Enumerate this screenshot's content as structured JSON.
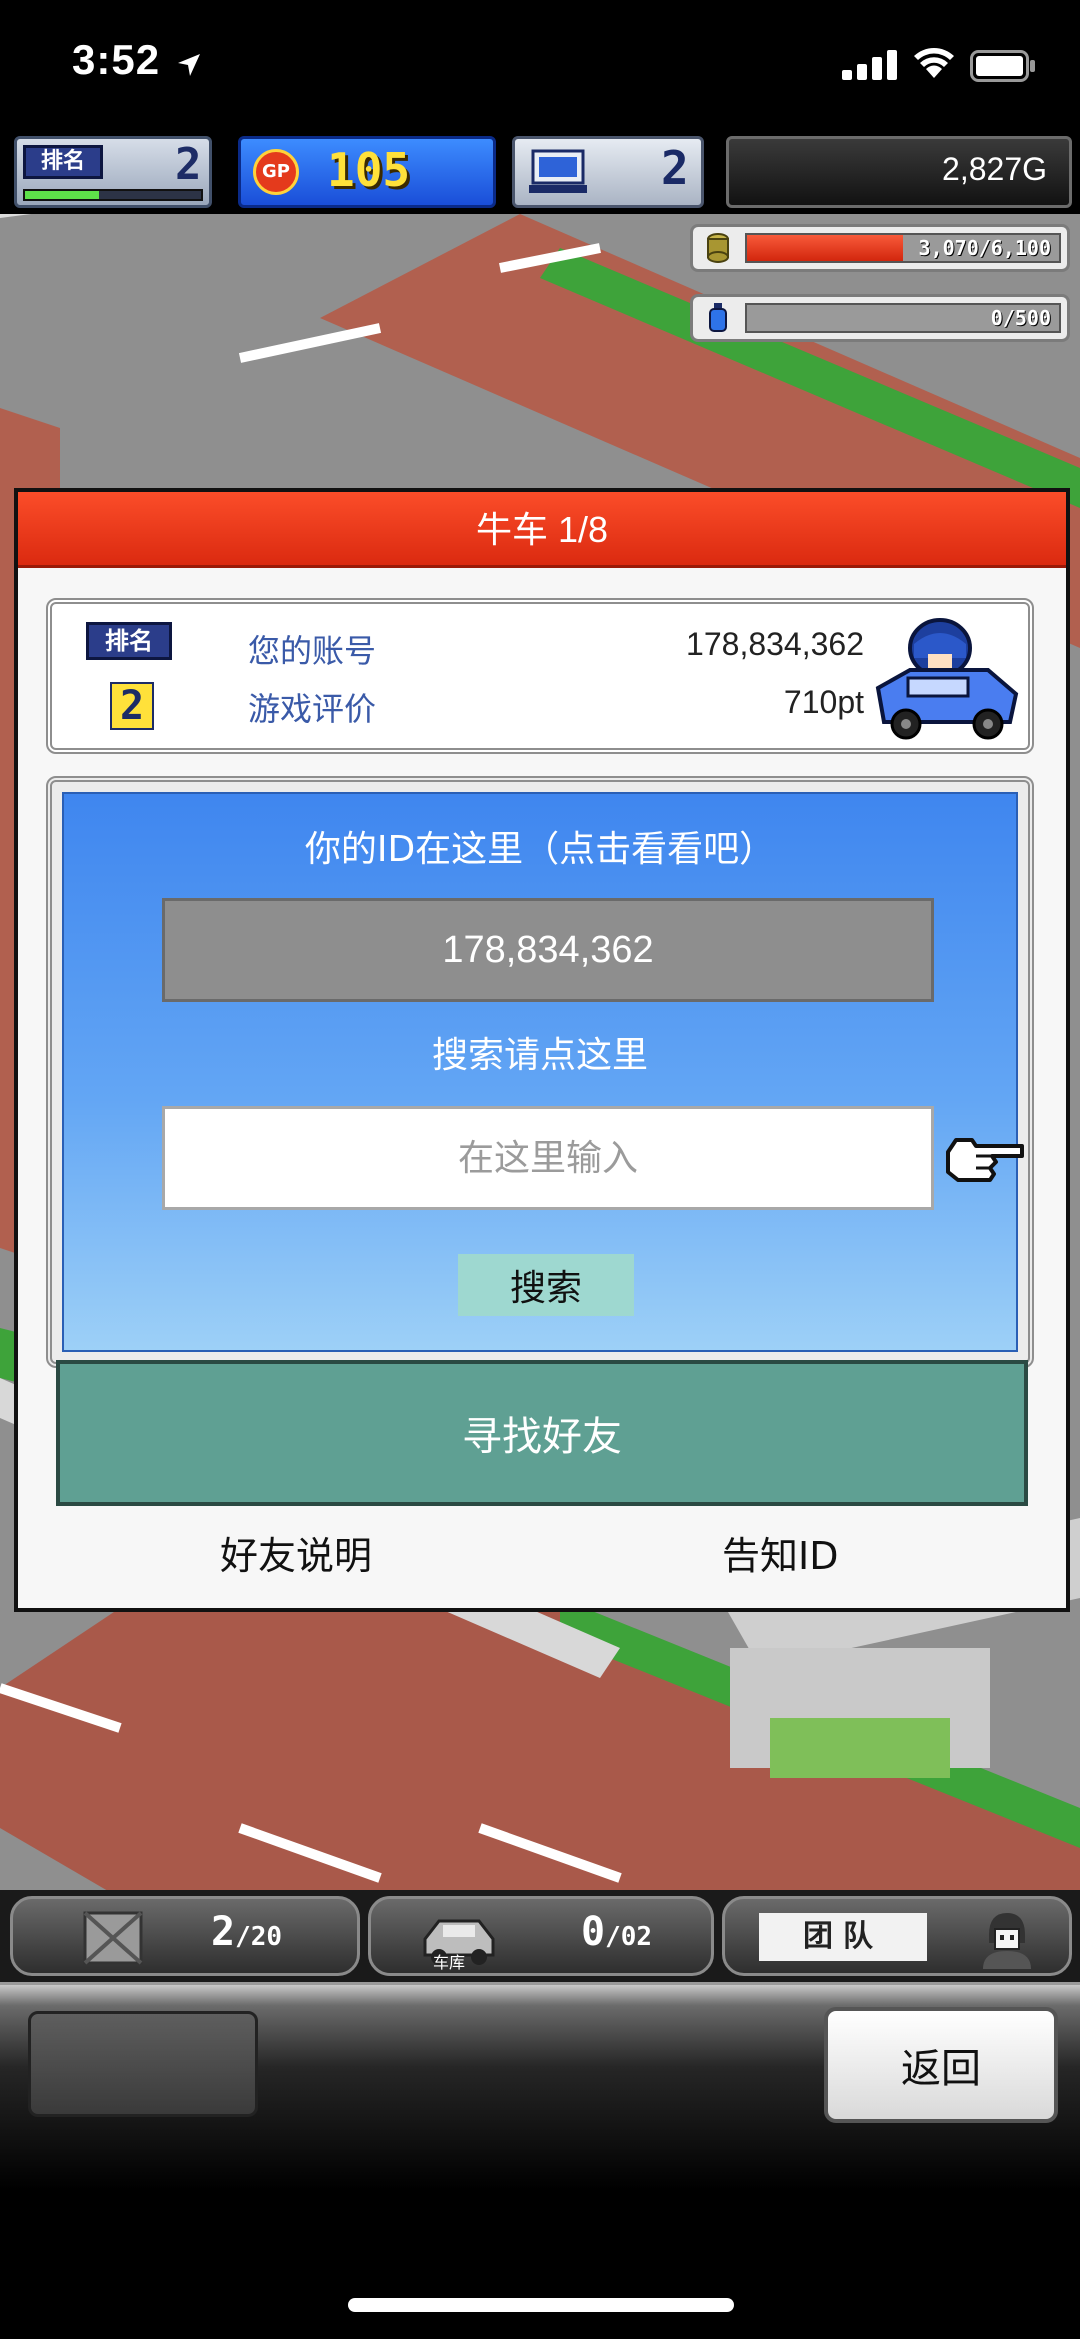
{
  "status_bar": {
    "time": "3:52"
  },
  "hud": {
    "rank_badge": "排名",
    "rank_value": "2",
    "rank_progress": 0.42,
    "gp_badge": "GP",
    "gp_value": "105",
    "pc_value": "2",
    "money": "2,827G",
    "resource1_text": "3,070/6,100",
    "resource1_fraction": 0.5,
    "resource2_text": "0/500",
    "resource2_fraction": 0.0
  },
  "dialog": {
    "title": "牛车 1/8",
    "rank_badge": "排名",
    "rank_value": "2",
    "account_label": "您的账号",
    "account_value": "178,834,362",
    "rating_label": "游戏评价",
    "rating_value": "710pt",
    "id_caption": "你的ID在这里（点击看看吧）",
    "id_value": "178,834,362",
    "search_caption": "搜索请点这里",
    "search_placeholder": "在这里输入",
    "search_button": "搜索",
    "find_friend_button": "寻找好友",
    "friend_help_link": "好友说明",
    "notify_id_link": "告知ID"
  },
  "bottom_status": {
    "crate_count": "2",
    "crate_max": "/20",
    "garage_count": "0",
    "garage_max": "/02",
    "garage_label": "车库",
    "team_label": "团队"
  },
  "command_bar": {
    "back_button": "返回"
  },
  "icons": {
    "location": "location-arrow-icon",
    "signal": "cellular-signal-icon",
    "wifi": "wifi-icon",
    "battery": "battery-icon",
    "gp": "gp-coin-icon",
    "computer": "computer-icon",
    "coins": "coin-stack-icon",
    "bottle": "blue-bottle-icon",
    "car": "car-driver-icon",
    "hand": "pointing-hand-icon",
    "crate": "crate-icon",
    "garage": "garage-car-icon",
    "person": "person-avatar-icon"
  },
  "colors": {
    "header_red": "#f03a1c",
    "panel_blue": "#3f86ef",
    "find_button_teal": "#5fa093",
    "search_button_mint": "#9ed8d0"
  }
}
